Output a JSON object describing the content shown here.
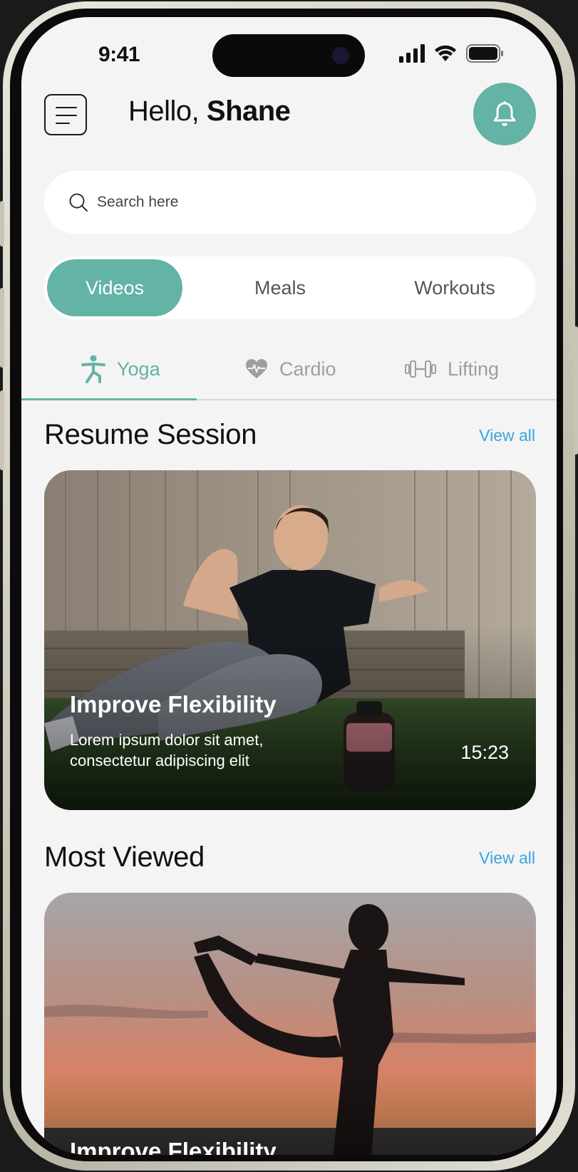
{
  "status_bar": {
    "time": "9:41"
  },
  "header": {
    "greeting_prefix": "Hello, ",
    "user_name": "Shane"
  },
  "search": {
    "placeholder": "Search here"
  },
  "segments": [
    {
      "label": "Videos",
      "active": true
    },
    {
      "label": "Meals",
      "active": false
    },
    {
      "label": "Workouts",
      "active": false
    }
  ],
  "categories": [
    {
      "label": "Yoga",
      "icon": "person-stretch-icon",
      "active": true
    },
    {
      "label": "Cardio",
      "icon": "heart-pulse-icon",
      "active": false
    },
    {
      "label": "Lifting",
      "icon": "dumbbell-icon",
      "active": false
    }
  ],
  "resume_section": {
    "title": "Resume Session",
    "view_all": "View all",
    "card": {
      "title": "Improve Flexibility",
      "subtitle_line1": "Lorem ipsum dolor sit amet,",
      "subtitle_line2": "consectetur adipiscing elit",
      "duration": "15:23"
    }
  },
  "most_viewed_section": {
    "title": "Most Viewed",
    "view_all": "View all",
    "card": {
      "title": "Improve Flexibility"
    }
  },
  "colors": {
    "accent": "#63b3a6",
    "link": "#3aa3df",
    "background": "#f4f4f4"
  }
}
